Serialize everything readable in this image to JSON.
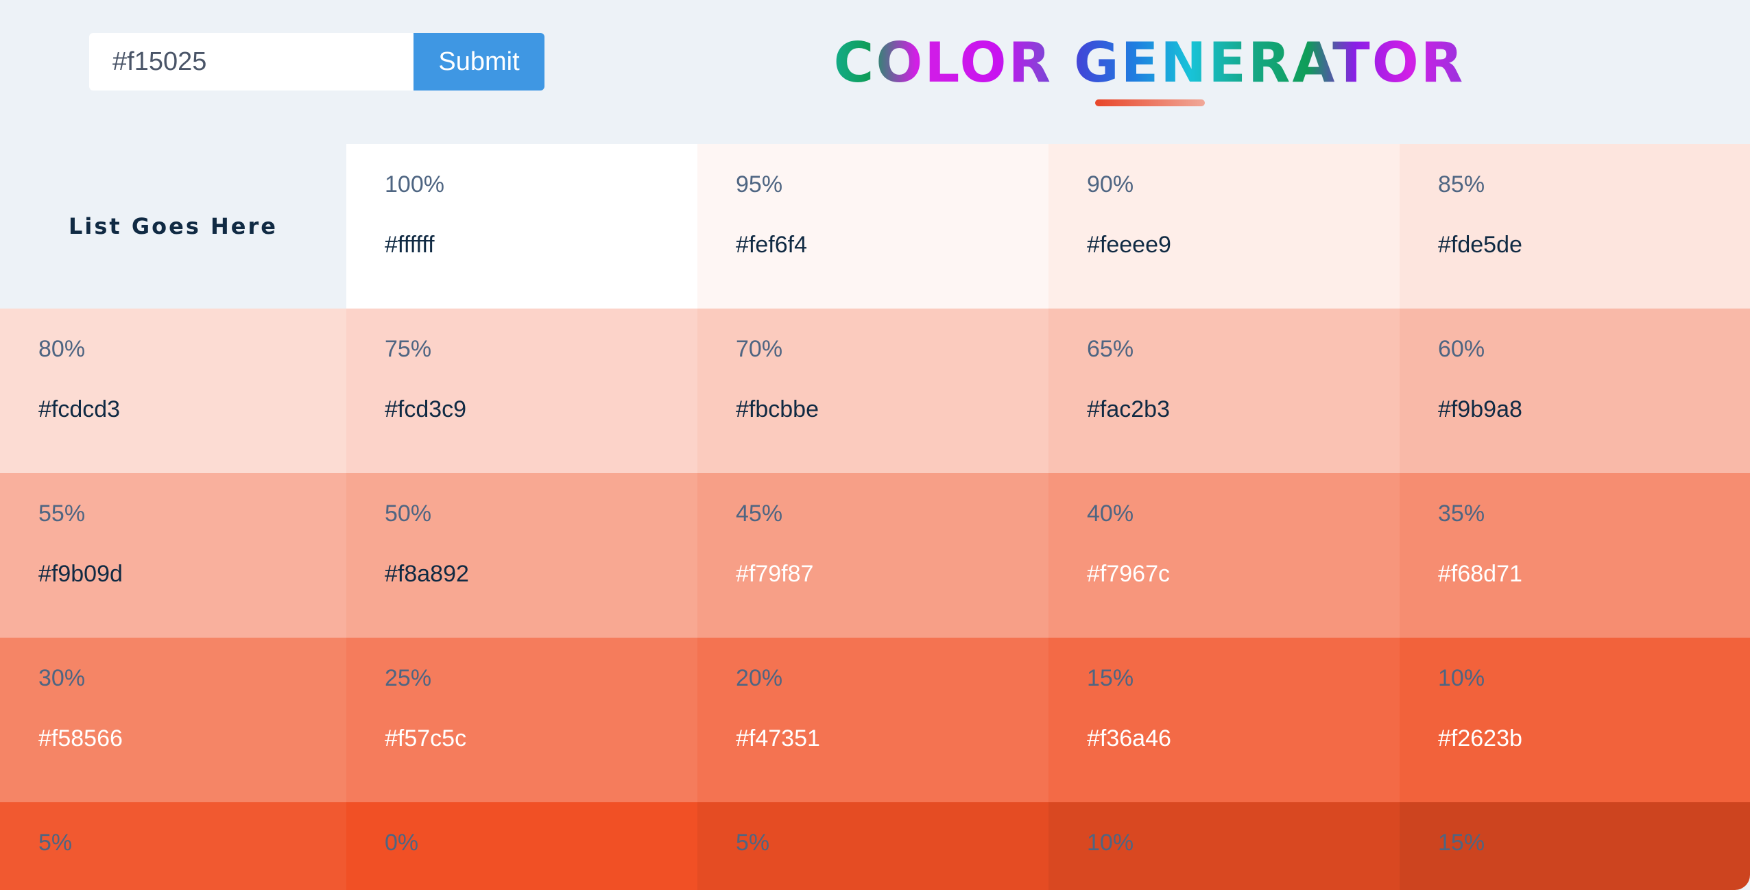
{
  "form": {
    "input_value": "#f15025",
    "submit_label": "Submit"
  },
  "header": {
    "title": "COLOR GENERATOR"
  },
  "list_label": "List Goes Here",
  "colors": [
    {
      "percent": "100%",
      "hex": "#ffffff",
      "bg": "#ffffff",
      "text": "#102a43"
    },
    {
      "percent": "95%",
      "hex": "#fef6f4",
      "bg": "#fef6f4",
      "text": "#102a43"
    },
    {
      "percent": "90%",
      "hex": "#feeee9",
      "bg": "#feeee9",
      "text": "#102a43"
    },
    {
      "percent": "85%",
      "hex": "#fde5de",
      "bg": "#fde5de",
      "text": "#102a43"
    },
    {
      "percent": "80%",
      "hex": "#fcdcd3",
      "bg": "#fcdcd3",
      "text": "#102a43"
    },
    {
      "percent": "75%",
      "hex": "#fcd3c9",
      "bg": "#fcd3c9",
      "text": "#102a43"
    },
    {
      "percent": "70%",
      "hex": "#fbcbbe",
      "bg": "#fbcbbe",
      "text": "#102a43"
    },
    {
      "percent": "65%",
      "hex": "#fac2b3",
      "bg": "#fac2b3",
      "text": "#102a43"
    },
    {
      "percent": "60%",
      "hex": "#f9b9a8",
      "bg": "#f9b9a8",
      "text": "#102a43"
    },
    {
      "percent": "55%",
      "hex": "#f9b09d",
      "bg": "#f9b09d",
      "text": "#102a43"
    },
    {
      "percent": "50%",
      "hex": "#f8a892",
      "bg": "#f8a892",
      "text": "#102a43"
    },
    {
      "percent": "45%",
      "hex": "#f79f87",
      "bg": "#f79f87",
      "text": "#ffffff"
    },
    {
      "percent": "40%",
      "hex": "#f7967c",
      "bg": "#f7967c",
      "text": "#ffffff"
    },
    {
      "percent": "35%",
      "hex": "#f68d71",
      "bg": "#f68d71",
      "text": "#ffffff"
    },
    {
      "percent": "30%",
      "hex": "#f58566",
      "bg": "#f58566",
      "text": "#ffffff"
    },
    {
      "percent": "25%",
      "hex": "#f57c5c",
      "bg": "#f57c5c",
      "text": "#ffffff"
    },
    {
      "percent": "20%",
      "hex": "#f47351",
      "bg": "#f47351",
      "text": "#ffffff"
    },
    {
      "percent": "15%",
      "hex": "#f36a46",
      "bg": "#f36a46",
      "text": "#ffffff"
    },
    {
      "percent": "10%",
      "hex": "#f2623b",
      "bg": "#f2623b",
      "text": "#ffffff"
    },
    {
      "percent": "5%",
      "hex": "",
      "bg": "#f15930",
      "text": "#ffffff"
    },
    {
      "percent": "0%",
      "hex": "",
      "bg": "#f15025",
      "text": "#ffffff"
    },
    {
      "percent": "5%",
      "hex": "",
      "bg": "#e54c23",
      "text": "#ffffff"
    },
    {
      "percent": "10%",
      "hex": "#",
      "bg": "#d94821",
      "text": "#ffffff"
    },
    {
      "percent": "15%",
      "hex": "",
      "bg": "#cd441f",
      "text": "#ffffff"
    }
  ]
}
